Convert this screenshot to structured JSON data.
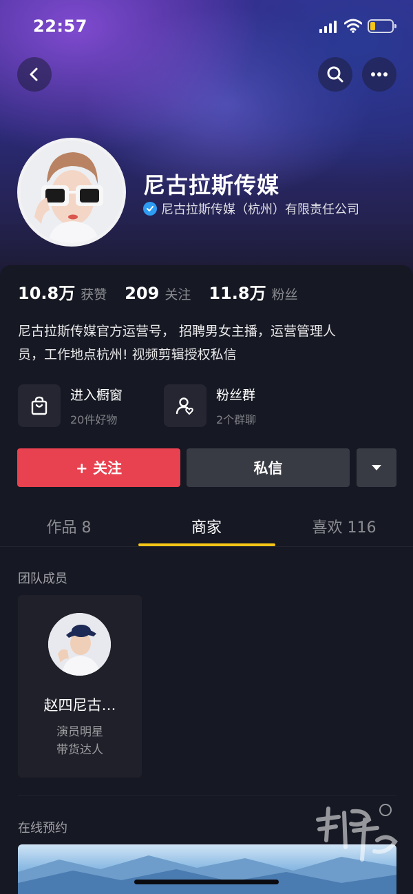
{
  "status_bar": {
    "time": "22:57"
  },
  "profile": {
    "name": "尼古拉斯传媒",
    "verification": "尼古拉斯传媒（杭州）有限责任公司",
    "stats": [
      {
        "value": "10.8万",
        "label": "获赞"
      },
      {
        "value": "209",
        "label": "关注"
      },
      {
        "value": "11.8万",
        "label": "粉丝"
      }
    ],
    "bio_line1": "尼古拉斯传媒官方运营号， 招聘男女主播，运营管理人",
    "bio_line2": "员，工作地点杭州! 视频剪辑授权私信"
  },
  "entries": [
    {
      "title": "进入橱窗",
      "subtitle": "20件好物",
      "icon": "shopping-bag-icon"
    },
    {
      "title": "粉丝群",
      "subtitle": "2个群聊",
      "icon": "fan-group-icon"
    }
  ],
  "actions": {
    "follow": "+ 关注",
    "message": "私信"
  },
  "tabs": [
    {
      "label": "作品 8",
      "active": false
    },
    {
      "label": "商家",
      "active": true
    },
    {
      "label": "喜欢 116",
      "active": false
    }
  ],
  "team": {
    "title": "团队成员",
    "members": [
      {
        "name": "赵四尼古…",
        "tag1": "演员明星",
        "tag2": "带货达人"
      }
    ]
  },
  "booking": {
    "title": "在线预约"
  },
  "colors": {
    "follow": "#e8414f",
    "tab_indicator": "#f5c518",
    "verified": "#2f9cf4",
    "background": "#161823"
  }
}
